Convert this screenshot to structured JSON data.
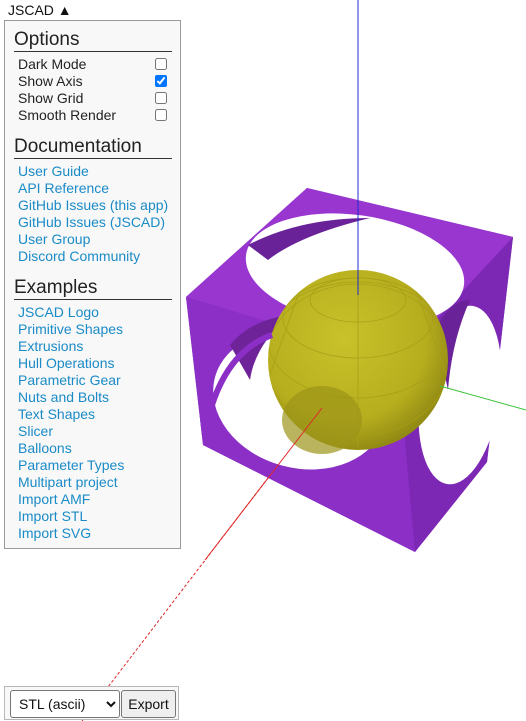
{
  "app": {
    "title": "JSCAD",
    "toggle_arrow": "▲"
  },
  "options": {
    "title": "Options",
    "items": [
      {
        "label": "Dark Mode",
        "checked": false
      },
      {
        "label": "Show Axis",
        "checked": true
      },
      {
        "label": "Show Grid",
        "checked": false
      },
      {
        "label": "Smooth Render",
        "checked": false
      }
    ]
  },
  "documentation": {
    "title": "Documentation",
    "links": [
      "User Guide",
      "API Reference",
      "GitHub Issues (this app)",
      "GitHub Issues (JSCAD)",
      "User Group",
      "Discord Community"
    ]
  },
  "examples": {
    "title": "Examples",
    "links": [
      "JSCAD Logo",
      "Primitive Shapes",
      "Extrusions",
      "Hull Operations",
      "Parametric Gear",
      "Nuts and Bolts",
      "Text Shapes",
      "Slicer",
      "Balloons",
      "Parameter Types",
      "Multipart project",
      "Import AMF",
      "Import STL",
      "Import SVG"
    ]
  },
  "export": {
    "format_selected": "STL (ascii)",
    "button_label": "Export"
  },
  "colors": {
    "link": "#1a8bc7",
    "cube": "#8a2fc4",
    "sphere": "#c4b82a",
    "axis_z": "#1f2cd0",
    "axis_x": "#e02828",
    "axis_y": "#3ac23a"
  }
}
